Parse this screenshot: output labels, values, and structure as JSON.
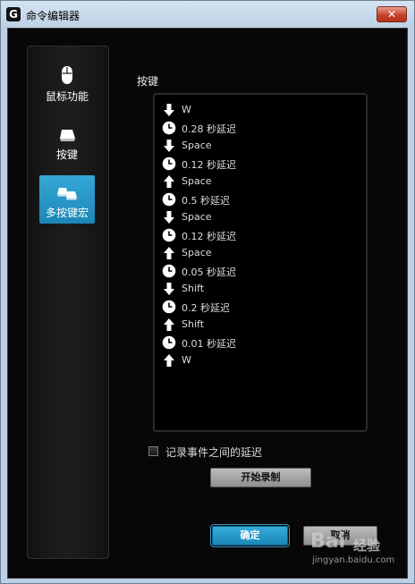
{
  "window": {
    "title": "命令编辑器",
    "logo": "G",
    "close": "✕"
  },
  "sidebar": {
    "items": [
      {
        "label": "鼠标功能",
        "icon": "mouse-icon"
      },
      {
        "label": "按键",
        "icon": "key-icon"
      },
      {
        "label": "多按键宏",
        "icon": "multi-key-icon",
        "selected": true
      }
    ]
  },
  "section_label": "按键",
  "macro": {
    "rows": [
      {
        "type": "key-down",
        "text": "W"
      },
      {
        "type": "delay",
        "text": "0.28 秒延迟"
      },
      {
        "type": "key-down",
        "text": "Space"
      },
      {
        "type": "delay",
        "text": "0.12 秒延迟"
      },
      {
        "type": "key-up",
        "text": "Space"
      },
      {
        "type": "delay",
        "text": "0.5 秒延迟"
      },
      {
        "type": "key-down",
        "text": "Space"
      },
      {
        "type": "delay",
        "text": "0.12 秒延迟"
      },
      {
        "type": "key-up",
        "text": "Space"
      },
      {
        "type": "delay",
        "text": "0.05 秒延迟"
      },
      {
        "type": "key-down",
        "text": "Shift"
      },
      {
        "type": "delay",
        "text": "0.2 秒延迟"
      },
      {
        "type": "key-up",
        "text": "Shift"
      },
      {
        "type": "delay",
        "text": "0.01 秒延迟"
      },
      {
        "type": "key-up",
        "text": "W"
      }
    ]
  },
  "record_delays": {
    "label": "记录事件之间的延迟",
    "checked": false
  },
  "buttons": {
    "start_record": "开始录制",
    "ok": "确定",
    "cancel": "取消"
  },
  "watermark": {
    "logo": "Bai",
    "brand": "经验",
    "url": "jingyan.baidu.com"
  },
  "colors": {
    "accent": "#1f92c4",
    "background": "#070707",
    "text": "#dcdcdc"
  }
}
